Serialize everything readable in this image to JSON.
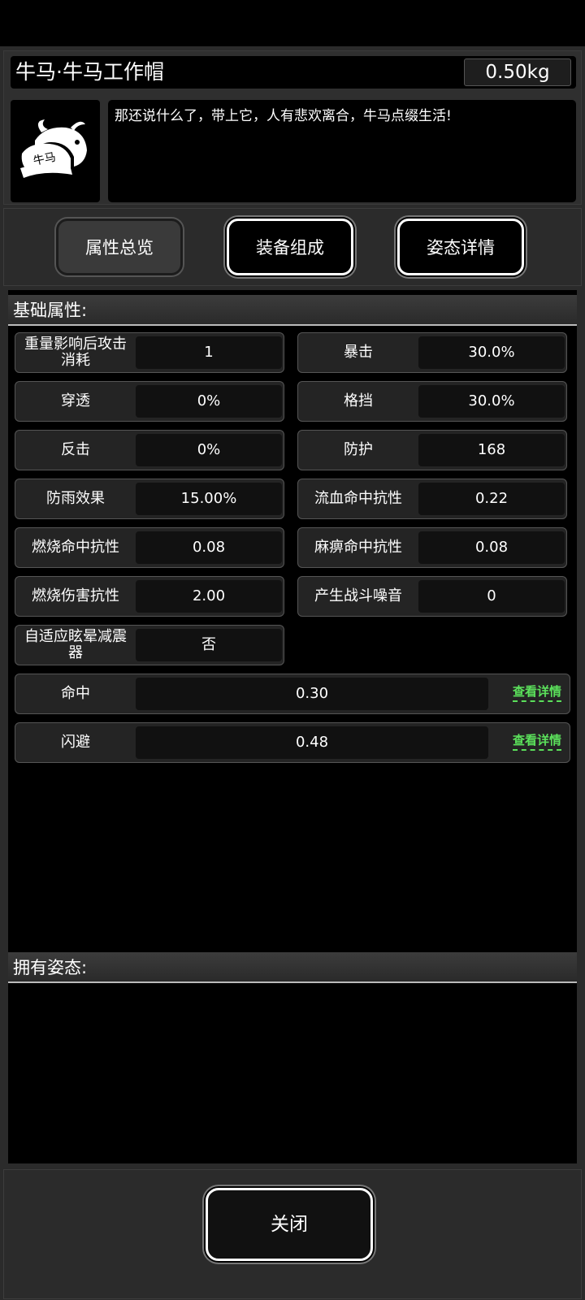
{
  "item": {
    "title": "牛马·牛马工作帽",
    "weight": "0.50kg",
    "description": "那还说什么了，带上它，人有悲欢离合，牛马点缀生活!",
    "icon": "bull-helmet-icon"
  },
  "tabs": [
    {
      "label": "属性总览",
      "active": true
    },
    {
      "label": "装备组成",
      "active": false
    },
    {
      "label": "姿态详情",
      "active": false
    }
  ],
  "sections": {
    "base": "基础属性:",
    "stances": "拥有姿态:"
  },
  "stats": [
    {
      "label": "重量影响后攻击消耗",
      "value": "1"
    },
    {
      "label": "暴击",
      "value": "30.0%"
    },
    {
      "label": "穿透",
      "value": "0%"
    },
    {
      "label": "格挡",
      "value": "30.0%"
    },
    {
      "label": "反击",
      "value": "0%"
    },
    {
      "label": "防护",
      "value": "168"
    },
    {
      "label": "防雨效果",
      "value": "15.00%"
    },
    {
      "label": "流血命中抗性",
      "value": "0.22"
    },
    {
      "label": "燃烧命中抗性",
      "value": "0.08"
    },
    {
      "label": "麻痹命中抗性",
      "value": "0.08"
    },
    {
      "label": "燃烧伤害抗性",
      "value": "2.00"
    },
    {
      "label": "产生战斗噪音",
      "value": "0"
    },
    {
      "label": "自适应眩晕减震器",
      "value": "否"
    }
  ],
  "wide_stats": [
    {
      "label": "命中",
      "value": "0.30",
      "link": "查看详情"
    },
    {
      "label": "闪避",
      "value": "0.48",
      "link": "查看详情"
    }
  ],
  "footer": {
    "close_label": "关闭"
  },
  "colors": {
    "link": "#5be05b",
    "panel": "#2b2b2b",
    "background": "#000000"
  }
}
